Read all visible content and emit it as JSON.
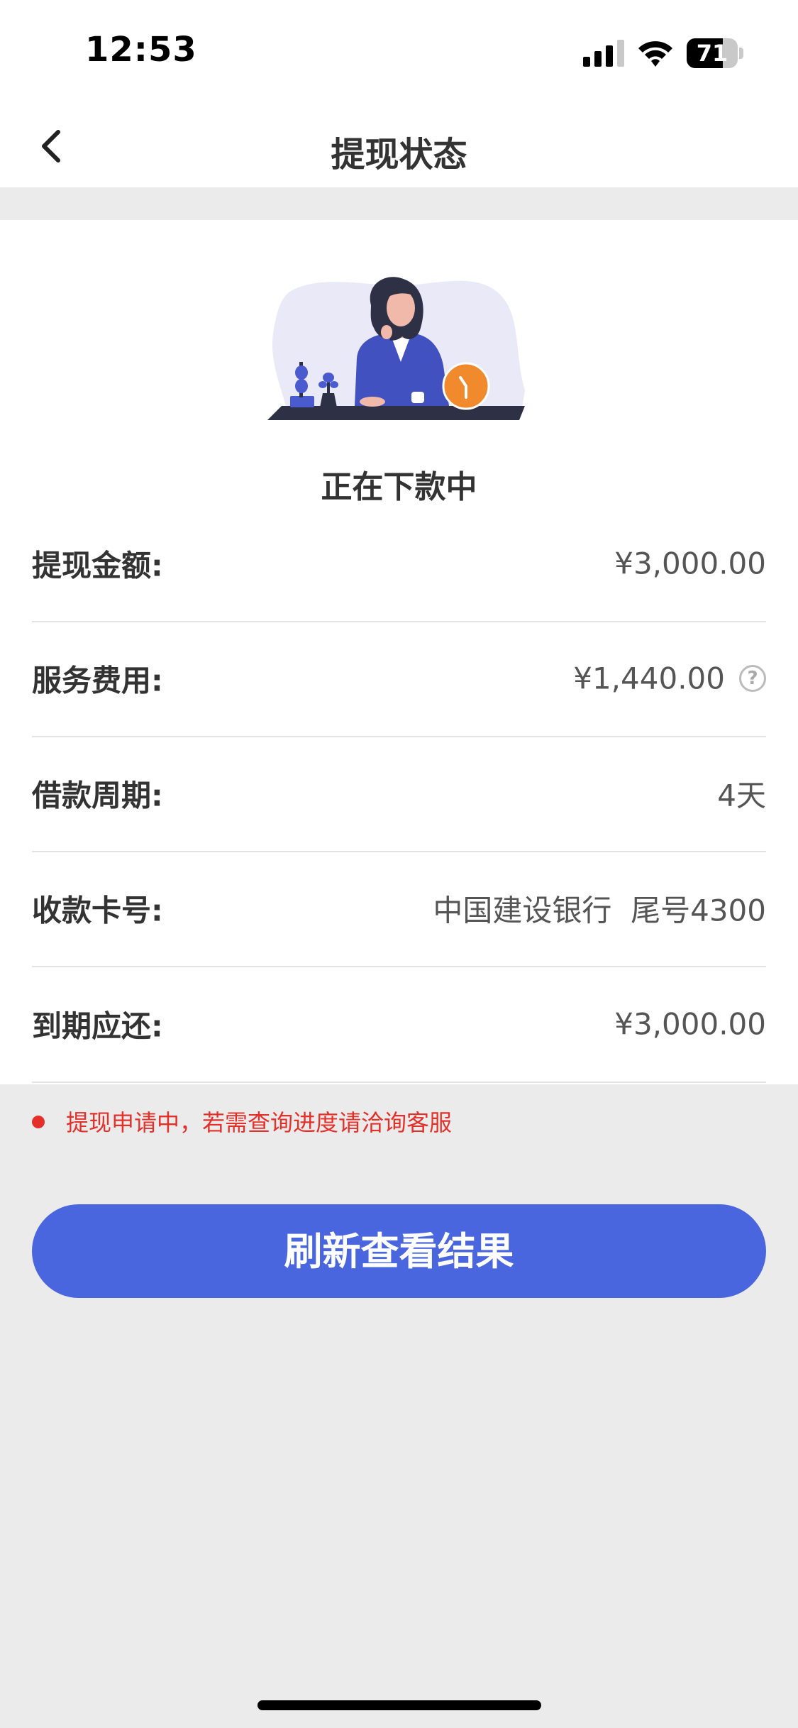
{
  "status_bar": {
    "time": "12:53",
    "battery_level": "71",
    "icons": [
      "signal-icon",
      "wifi-icon",
      "battery-icon"
    ]
  },
  "nav": {
    "title": "提现状态",
    "back_icon": "chevron-left-icon"
  },
  "status": {
    "illustration": "woman-waiting-clock-illustration",
    "heading": "正在下款中"
  },
  "details": [
    {
      "label": "提现金额:",
      "value": "¥3,000.00"
    },
    {
      "label": "服务费用:",
      "value": "¥1,440.00",
      "help_icon": "?"
    },
    {
      "label": "借款周期:",
      "value": "4天"
    },
    {
      "label": "收款卡号:",
      "value": "中国建设银行  尾号4300"
    },
    {
      "label": "到期应还:",
      "value": "¥3,000.00"
    }
  ],
  "notice": {
    "text": "提现申请中，若需查询进度请洽询客服"
  },
  "actions": {
    "refresh_label": "刷新查看结果"
  },
  "colors": {
    "accent": "#4a66de",
    "warning": "#e5302a",
    "background": "#ebebec",
    "clock_orange": "#f08a2c"
  }
}
